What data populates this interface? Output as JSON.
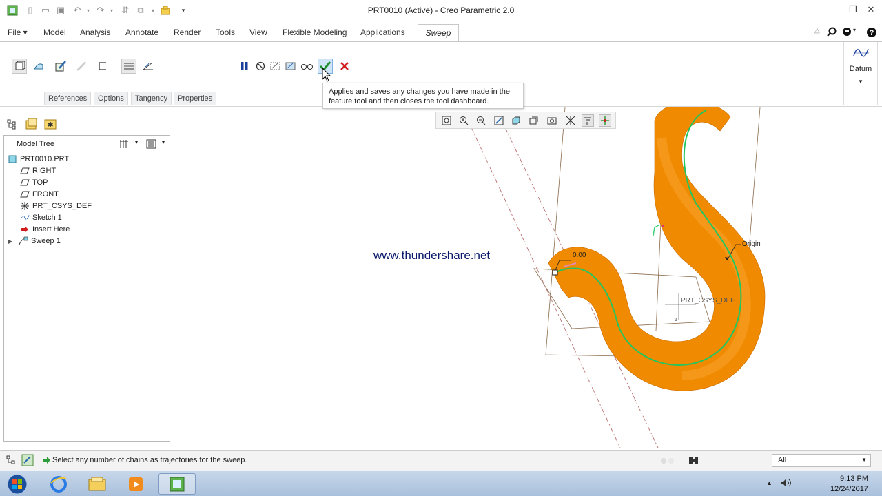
{
  "window": {
    "title": "PRT0010 (Active) - Creo Parametric 2.0"
  },
  "ribbon": {
    "tabs": [
      "File",
      "Model",
      "Analysis",
      "Annotate",
      "Render",
      "Tools",
      "View",
      "Flexible Modeling",
      "Applications"
    ],
    "active_tab": "Sweep",
    "subtabs": [
      "References",
      "Options",
      "Tangency",
      "Properties"
    ],
    "datum_label": "Datum"
  },
  "tooltip": {
    "text": "Applies and saves any changes you have made in the feature tool and then closes the tool dashboard."
  },
  "model_tree": {
    "title": "Model Tree",
    "items": [
      {
        "label": "PRT0010.PRT",
        "icon": "part-icon"
      },
      {
        "label": "RIGHT",
        "icon": "datum-plane-icon"
      },
      {
        "label": "TOP",
        "icon": "datum-plane-icon"
      },
      {
        "label": "FRONT",
        "icon": "datum-plane-icon"
      },
      {
        "label": "PRT_CSYS_DEF",
        "icon": "csys-icon"
      },
      {
        "label": "Sketch 1",
        "icon": "sketch-icon"
      },
      {
        "label": "Insert Here",
        "icon": "insert-arrow-icon"
      },
      {
        "label": "Sweep 1",
        "icon": "sweep-icon"
      }
    ]
  },
  "graphics": {
    "watermark": "www.thundershare.net",
    "dimension_label": "0.00",
    "origin_label": "Origin",
    "csys_label": "PRT_CSYS_DEF",
    "z_label": "z",
    "sweep_color": "#f08a00",
    "trajectory_color": "#22c55e"
  },
  "status": {
    "message": "Select any number of chains as trajectories for the sweep.",
    "filter": "All"
  },
  "taskbar": {
    "time": "9:13 PM",
    "date": "12/24/2017"
  }
}
